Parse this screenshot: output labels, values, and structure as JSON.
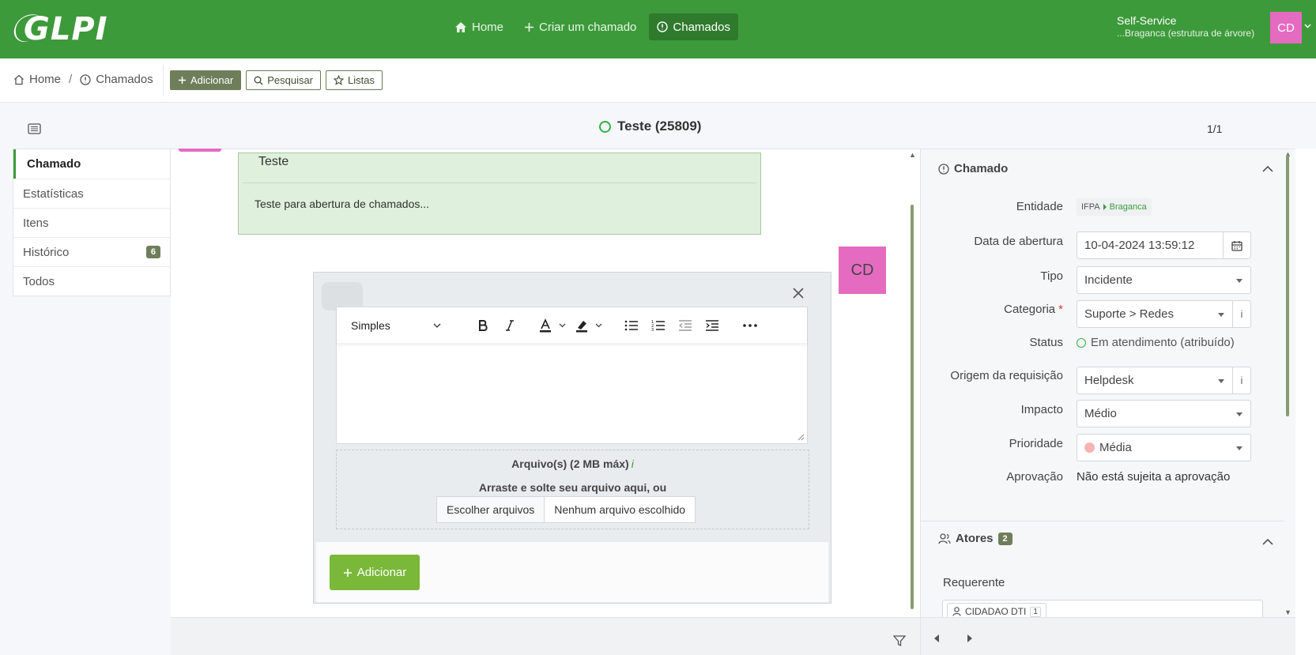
{
  "app": {
    "logo_text": "GLPI"
  },
  "topnav": [
    {
      "label": "Home",
      "icon": "home-icon"
    },
    {
      "label": "Criar um chamado",
      "icon": "plus-icon"
    },
    {
      "label": "Chamados",
      "icon": "alert-circle-icon",
      "active": true
    }
  ],
  "profile": {
    "name": "Self-Service",
    "entity": "...Braganca (estrutura de árvore)",
    "initials": "CD",
    "avatar_color": "#e56bc1"
  },
  "breadcrumb": {
    "home": "Home",
    "current": "Chamados"
  },
  "actions": {
    "add": "Adicionar",
    "search": "Pesquisar",
    "lists": "Listas"
  },
  "ticket": {
    "title": "Teste (25809)",
    "pager": "1/1"
  },
  "tabs": [
    {
      "label": "Chamado",
      "active": true
    },
    {
      "label": "Estatísticas"
    },
    {
      "label": "Itens"
    },
    {
      "label": "Histórico",
      "badge": "6"
    },
    {
      "label": "Todos"
    }
  ],
  "description": {
    "title": "Teste",
    "body": "Teste para abertura de chamados..."
  },
  "followup": {
    "format_select": "Simples",
    "attach_title": "Arquivo(s) (2 MB máx)",
    "attach_info": "i",
    "drop_text": "Arraste e solte seu arquivo aqui, ou",
    "choose_files": "Escolher arquivos",
    "no_file": "Nenhum arquivo escolhido",
    "submit": "Adicionar",
    "author_initials": "CD"
  },
  "panel": {
    "section_ticket": "Chamado",
    "fields": {
      "entity_label": "Entidade",
      "entity_root": "IFPA",
      "entity_sub": "Braganca",
      "date_label": "Data de abertura",
      "date_value": "10-04-2024 13:59:12",
      "type_label": "Tipo",
      "type_value": "Incidente",
      "category_label": "Categoria",
      "category_value": "Suporte > Redes",
      "category_required": "*",
      "status_label": "Status",
      "status_value": "Em atendimento (atribuído)",
      "origin_label": "Origem da requisição",
      "origin_value": "Helpdesk",
      "impact_label": "Impacto",
      "impact_value": "Médio",
      "priority_label": "Prioridade",
      "priority_value": "Média",
      "approval_label": "Aprovação",
      "approval_value": "Não está sujeita a aprovação",
      "info_glyph": "i"
    },
    "section_actors": "Atores",
    "actors_count": "2",
    "requester_label": "Requerente",
    "requester_name": "CIDADAO DTI",
    "requester_count": "1"
  },
  "colors": {
    "brand": "#3d9a3a",
    "active_nav": "#2f7a2c",
    "description_bg": "#dff0dc",
    "submit": "#7ab83a",
    "badge": "#6e7e5a"
  }
}
